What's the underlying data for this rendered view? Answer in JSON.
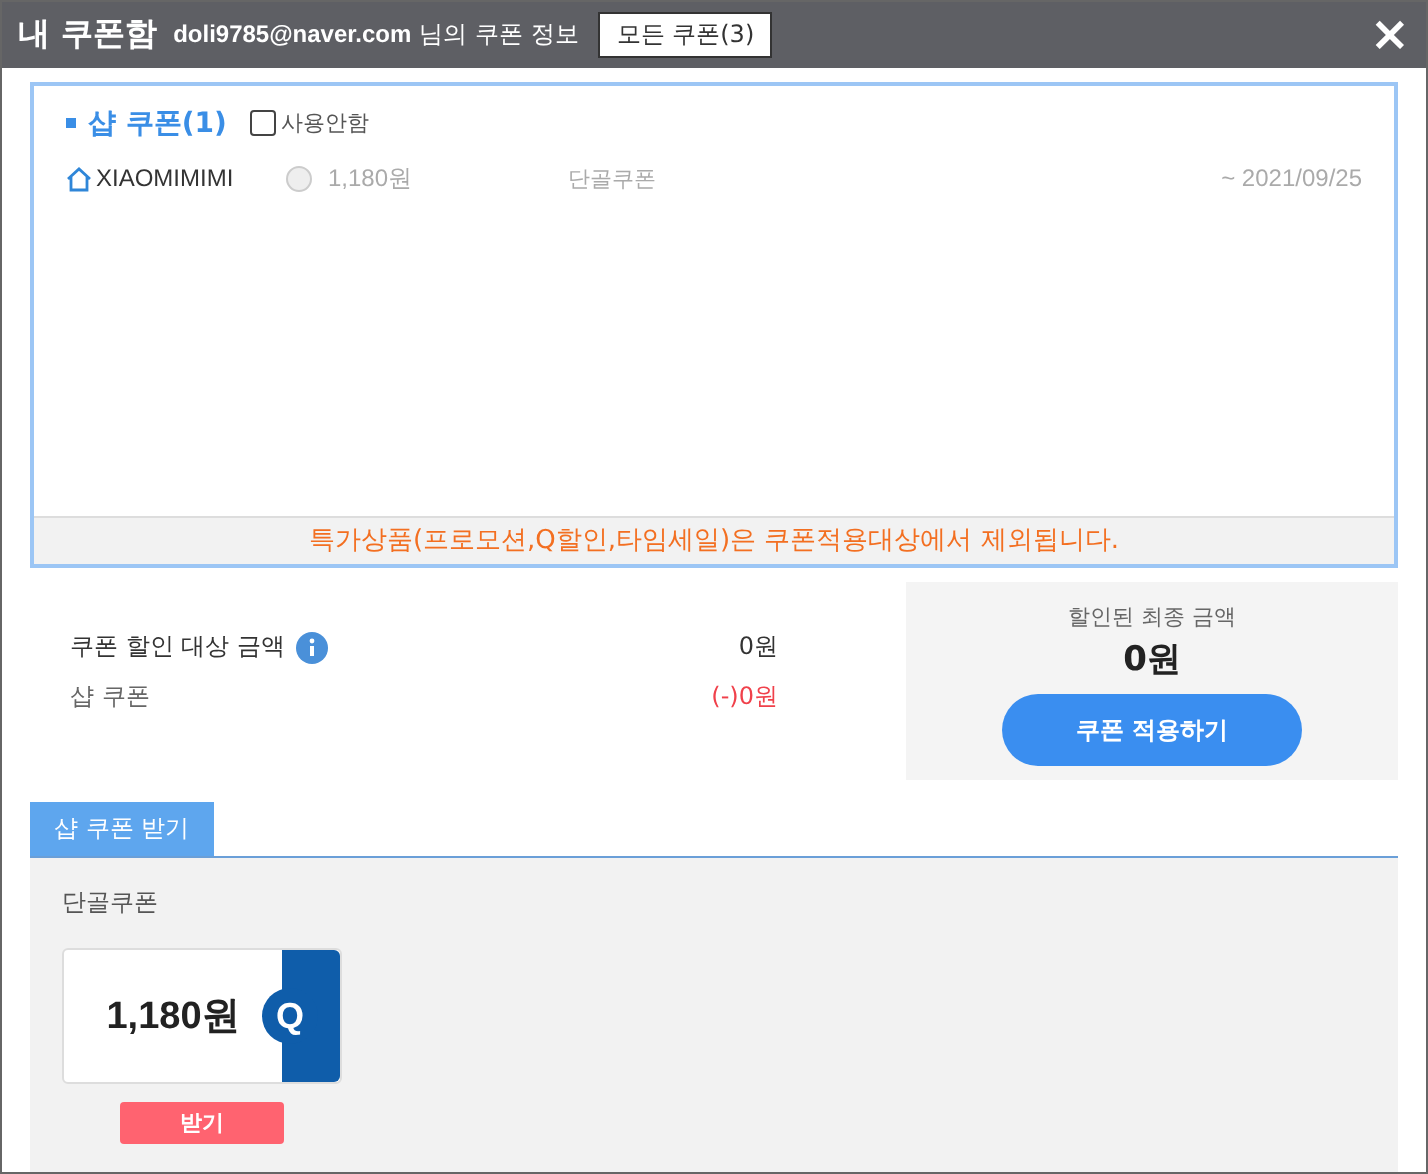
{
  "header": {
    "title": "내 쿠폰함",
    "user": "doli9785@naver.com",
    "user_suffix": "님의 쿠폰 정보",
    "all_button": "모든 쿠폰(3)",
    "close": "×"
  },
  "shop_coupons": {
    "title": "샵 쿠폰(1)",
    "unused_label": "사용안함",
    "unused_checked": false,
    "rows": [
      {
        "store": "XIAOMIMIMI",
        "selected": false,
        "amount": "1,180원",
        "type": "단골쿠폰",
        "expiry": "~ 2021/09/25"
      }
    ],
    "notice": "특가상품(프로모션,Q할인,타임세일)은 쿠폰적용대상에서 제외됩니다."
  },
  "summary": {
    "lines": [
      {
        "label": "쿠폰 할인 대상 금액",
        "info": true,
        "value": "0원",
        "kind": "plain"
      },
      {
        "label": "샵 쿠폰",
        "info": false,
        "value": "(-)0원",
        "kind": "discount"
      }
    ],
    "final_label": "할인된 최종 금액",
    "final_value": "0원",
    "apply_button": "쿠폰 적용하기"
  },
  "receive": {
    "tab": "샵 쿠폰 받기",
    "section": "단골쿠폰",
    "coupon_amount": "1,180원",
    "coupon_logo": "Q",
    "button": "받기"
  }
}
